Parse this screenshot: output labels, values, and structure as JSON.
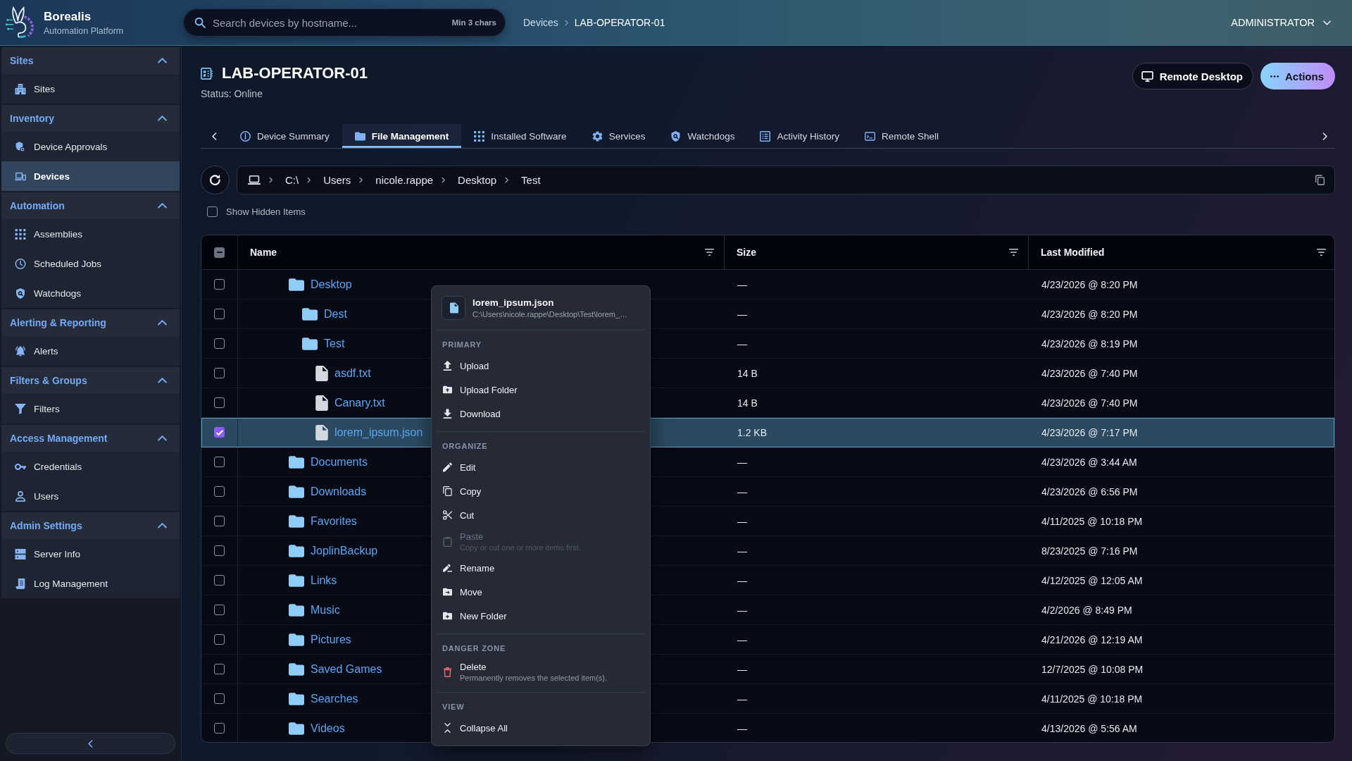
{
  "app": {
    "name": "Borealis",
    "subtitle": "Automation Platform"
  },
  "search": {
    "placeholder": "Search devices by hostname...",
    "hint": "Min 3 chars"
  },
  "breadcrumb": [
    "Devices",
    "LAB-OPERATOR-01"
  ],
  "user_menu": {
    "label": "ADMINISTRATOR"
  },
  "sidebar": {
    "sections": [
      {
        "title": "Sites",
        "expanded": true,
        "items": [
          {
            "label": "Sites",
            "selected": false
          }
        ]
      },
      {
        "title": "Inventory",
        "expanded": true,
        "items": [
          {
            "label": "Device Approvals",
            "selected": false
          },
          {
            "label": "Devices",
            "selected": true
          }
        ]
      },
      {
        "title": "Automation",
        "expanded": true,
        "items": [
          {
            "label": "Assemblies",
            "selected": false
          },
          {
            "label": "Scheduled Jobs",
            "selected": false
          },
          {
            "label": "Watchdogs",
            "selected": false
          }
        ]
      },
      {
        "title": "Alerting & Reporting",
        "expanded": true,
        "items": [
          {
            "label": "Alerts",
            "selected": false
          }
        ]
      },
      {
        "title": "Filters & Groups",
        "expanded": true,
        "items": [
          {
            "label": "Filters",
            "selected": false
          }
        ]
      },
      {
        "title": "Access Management",
        "expanded": true,
        "items": [
          {
            "label": "Credentials",
            "selected": false
          },
          {
            "label": "Users",
            "selected": false
          }
        ]
      },
      {
        "title": "Admin Settings",
        "expanded": true,
        "items": [
          {
            "label": "Server Info",
            "selected": false
          },
          {
            "label": "Log Management",
            "selected": false
          }
        ]
      }
    ]
  },
  "page": {
    "title": "LAB-OPERATOR-01",
    "status": "Status: Online",
    "buttons": [
      {
        "label": "Remote Desktop",
        "kind": "secondary"
      },
      {
        "label": "Actions",
        "kind": "primary"
      }
    ]
  },
  "tabs": [
    {
      "label": "Device Summary",
      "selected": false
    },
    {
      "label": "File Management",
      "selected": true
    },
    {
      "label": "Installed Software",
      "selected": false
    },
    {
      "label": "Services",
      "selected": false
    },
    {
      "label": "Watchdogs",
      "selected": false
    },
    {
      "label": "Activity History",
      "selected": false
    },
    {
      "label": "Remote Shell",
      "selected": false
    }
  ],
  "path_bar": {
    "segments": [
      "C:\\",
      "Users",
      "nicole.rappe",
      "Desktop",
      "Test"
    ]
  },
  "show_hidden": {
    "label": "Show Hidden Items",
    "checked": false
  },
  "table": {
    "select_all": {
      "indeterminate": true
    },
    "columns": [
      "Name",
      "Size",
      "Last Modified"
    ],
    "rows": [
      {
        "name": "Desktop",
        "kind": "folder",
        "size": "—",
        "modified": "4/23/2026 @ 8:20 PM",
        "selected": false,
        "checked": false,
        "children": [
          {
            "name": "Dest",
            "kind": "folder",
            "size": "—",
            "modified": "4/23/2026 @ 8:20 PM",
            "selected": false,
            "checked": false
          },
          {
            "name": "Test",
            "kind": "folder",
            "size": "—",
            "modified": "4/23/2026 @ 8:19 PM",
            "selected": false,
            "checked": false,
            "children": [
              {
                "name": "asdf.txt",
                "kind": "file",
                "size": "14 B",
                "modified": "4/23/2026 @ 7:40 PM",
                "selected": false,
                "checked": false
              },
              {
                "name": "Canary.txt",
                "kind": "file",
                "size": "14 B",
                "modified": "4/23/2026 @ 7:40 PM",
                "selected": false,
                "checked": false
              },
              {
                "name": "lorem_ipsum.json",
                "kind": "file",
                "size": "1.2 KB",
                "modified": "4/23/2026 @ 7:17 PM",
                "selected": true,
                "checked": true
              }
            ]
          }
        ]
      },
      {
        "name": "Documents",
        "kind": "folder",
        "size": "—",
        "modified": "4/23/2026 @ 3:44 AM",
        "selected": false,
        "checked": false
      },
      {
        "name": "Downloads",
        "kind": "folder",
        "size": "—",
        "modified": "4/23/2026 @ 6:56 PM",
        "selected": false,
        "checked": false
      },
      {
        "name": "Favorites",
        "kind": "folder",
        "size": "—",
        "modified": "4/11/2025 @ 10:18 PM",
        "selected": false,
        "checked": false
      },
      {
        "name": "JoplinBackup",
        "kind": "folder",
        "size": "—",
        "modified": "8/23/2025 @ 7:16 PM",
        "selected": false,
        "checked": false
      },
      {
        "name": "Links",
        "kind": "folder",
        "size": "—",
        "modified": "4/12/2025 @ 12:05 AM",
        "selected": false,
        "checked": false
      },
      {
        "name": "Music",
        "kind": "folder",
        "size": "—",
        "modified": "4/2/2026 @ 8:49 PM",
        "selected": false,
        "checked": false
      },
      {
        "name": "Pictures",
        "kind": "folder",
        "size": "—",
        "modified": "4/21/2026 @ 12:19 AM",
        "selected": false,
        "checked": false
      },
      {
        "name": "Saved Games",
        "kind": "folder",
        "size": "—",
        "modified": "12/7/2025 @ 10:08 PM",
        "selected": false,
        "checked": false
      },
      {
        "name": "Searches",
        "kind": "folder",
        "size": "—",
        "modified": "4/11/2025 @ 10:18 PM",
        "selected": false,
        "checked": false
      },
      {
        "name": "Videos",
        "kind": "folder",
        "size": "—",
        "modified": "4/13/2026 @ 5:56 AM",
        "selected": false,
        "checked": false
      }
    ]
  },
  "context_menu": {
    "title": "lorem_ipsum.json",
    "path": "C:\\Users\\nicole.rappe\\Desktop\\Test\\lorem_…",
    "sections": [
      {
        "label": "PRIMARY",
        "kind": "normal",
        "items": [
          {
            "label": "Upload",
            "disabled": false
          },
          {
            "label": "Upload Folder",
            "disabled": false
          },
          {
            "label": "Download",
            "disabled": false
          }
        ]
      },
      {
        "label": "ORGANIZE",
        "kind": "normal",
        "items": [
          {
            "label": "Edit",
            "disabled": false
          },
          {
            "label": "Copy",
            "disabled": false
          },
          {
            "label": "Cut",
            "disabled": false
          },
          {
            "label": "Paste",
            "hint": "Copy or cut one or more items first.",
            "disabled": true
          },
          {
            "label": "Rename",
            "disabled": false
          },
          {
            "label": "Move",
            "disabled": false
          },
          {
            "label": "New Folder",
            "disabled": false
          }
        ]
      },
      {
        "label": "DANGER ZONE",
        "kind": "danger",
        "items": [
          {
            "label": "Delete",
            "hint": "Permanently removes the selected item(s).",
            "disabled": false
          }
        ]
      },
      {
        "label": "VIEW",
        "kind": "normal",
        "items": [
          {
            "label": "Collapse All",
            "disabled": false
          }
        ]
      }
    ]
  }
}
